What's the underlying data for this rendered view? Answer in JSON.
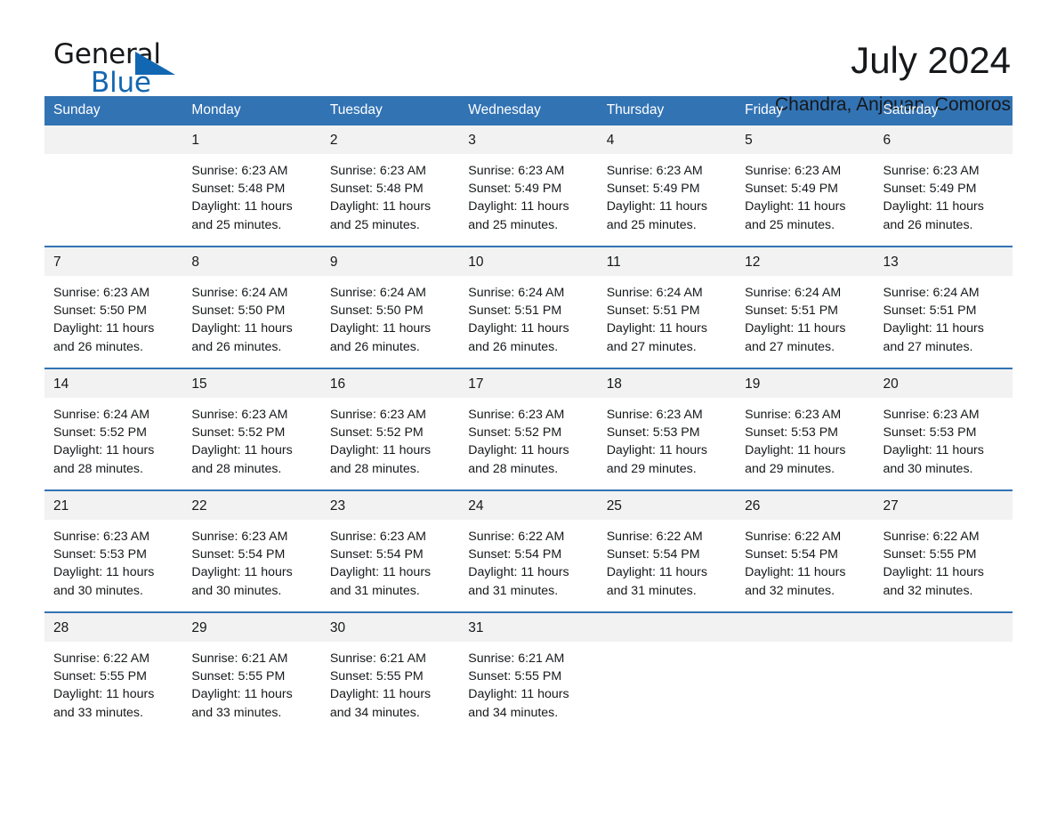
{
  "logo": {
    "word_one": "General",
    "word_two": "Blue",
    "triangle_color": "#1267b2"
  },
  "header": {
    "title": "July 2024",
    "location": "Chandra, Anjouan, Comoros",
    "accent_color": "#3273b4",
    "daynum_background": "#f2f2f2"
  },
  "weekday_headers": [
    "Sunday",
    "Monday",
    "Tuesday",
    "Wednesday",
    "Thursday",
    "Friday",
    "Saturday"
  ],
  "weeks": [
    [
      {
        "day": "",
        "sunrise": "",
        "sunset": "",
        "daylight_line1": "",
        "daylight_line2": ""
      },
      {
        "day": "1",
        "sunrise": "Sunrise: 6:23 AM",
        "sunset": "Sunset: 5:48 PM",
        "daylight_line1": "Daylight: 11 hours",
        "daylight_line2": "and 25 minutes."
      },
      {
        "day": "2",
        "sunrise": "Sunrise: 6:23 AM",
        "sunset": "Sunset: 5:48 PM",
        "daylight_line1": "Daylight: 11 hours",
        "daylight_line2": "and 25 minutes."
      },
      {
        "day": "3",
        "sunrise": "Sunrise: 6:23 AM",
        "sunset": "Sunset: 5:49 PM",
        "daylight_line1": "Daylight: 11 hours",
        "daylight_line2": "and 25 minutes."
      },
      {
        "day": "4",
        "sunrise": "Sunrise: 6:23 AM",
        "sunset": "Sunset: 5:49 PM",
        "daylight_line1": "Daylight: 11 hours",
        "daylight_line2": "and 25 minutes."
      },
      {
        "day": "5",
        "sunrise": "Sunrise: 6:23 AM",
        "sunset": "Sunset: 5:49 PM",
        "daylight_line1": "Daylight: 11 hours",
        "daylight_line2": "and 25 minutes."
      },
      {
        "day": "6",
        "sunrise": "Sunrise: 6:23 AM",
        "sunset": "Sunset: 5:49 PM",
        "daylight_line1": "Daylight: 11 hours",
        "daylight_line2": "and 26 minutes."
      }
    ],
    [
      {
        "day": "7",
        "sunrise": "Sunrise: 6:23 AM",
        "sunset": "Sunset: 5:50 PM",
        "daylight_line1": "Daylight: 11 hours",
        "daylight_line2": "and 26 minutes."
      },
      {
        "day": "8",
        "sunrise": "Sunrise: 6:24 AM",
        "sunset": "Sunset: 5:50 PM",
        "daylight_line1": "Daylight: 11 hours",
        "daylight_line2": "and 26 minutes."
      },
      {
        "day": "9",
        "sunrise": "Sunrise: 6:24 AM",
        "sunset": "Sunset: 5:50 PM",
        "daylight_line1": "Daylight: 11 hours",
        "daylight_line2": "and 26 minutes."
      },
      {
        "day": "10",
        "sunrise": "Sunrise: 6:24 AM",
        "sunset": "Sunset: 5:51 PM",
        "daylight_line1": "Daylight: 11 hours",
        "daylight_line2": "and 26 minutes."
      },
      {
        "day": "11",
        "sunrise": "Sunrise: 6:24 AM",
        "sunset": "Sunset: 5:51 PM",
        "daylight_line1": "Daylight: 11 hours",
        "daylight_line2": "and 27 minutes."
      },
      {
        "day": "12",
        "sunrise": "Sunrise: 6:24 AM",
        "sunset": "Sunset: 5:51 PM",
        "daylight_line1": "Daylight: 11 hours",
        "daylight_line2": "and 27 minutes."
      },
      {
        "day": "13",
        "sunrise": "Sunrise: 6:24 AM",
        "sunset": "Sunset: 5:51 PM",
        "daylight_line1": "Daylight: 11 hours",
        "daylight_line2": "and 27 minutes."
      }
    ],
    [
      {
        "day": "14",
        "sunrise": "Sunrise: 6:24 AM",
        "sunset": "Sunset: 5:52 PM",
        "daylight_line1": "Daylight: 11 hours",
        "daylight_line2": "and 28 minutes."
      },
      {
        "day": "15",
        "sunrise": "Sunrise: 6:23 AM",
        "sunset": "Sunset: 5:52 PM",
        "daylight_line1": "Daylight: 11 hours",
        "daylight_line2": "and 28 minutes."
      },
      {
        "day": "16",
        "sunrise": "Sunrise: 6:23 AM",
        "sunset": "Sunset: 5:52 PM",
        "daylight_line1": "Daylight: 11 hours",
        "daylight_line2": "and 28 minutes."
      },
      {
        "day": "17",
        "sunrise": "Sunrise: 6:23 AM",
        "sunset": "Sunset: 5:52 PM",
        "daylight_line1": "Daylight: 11 hours",
        "daylight_line2": "and 28 minutes."
      },
      {
        "day": "18",
        "sunrise": "Sunrise: 6:23 AM",
        "sunset": "Sunset: 5:53 PM",
        "daylight_line1": "Daylight: 11 hours",
        "daylight_line2": "and 29 minutes."
      },
      {
        "day": "19",
        "sunrise": "Sunrise: 6:23 AM",
        "sunset": "Sunset: 5:53 PM",
        "daylight_line1": "Daylight: 11 hours",
        "daylight_line2": "and 29 minutes."
      },
      {
        "day": "20",
        "sunrise": "Sunrise: 6:23 AM",
        "sunset": "Sunset: 5:53 PM",
        "daylight_line1": "Daylight: 11 hours",
        "daylight_line2": "and 30 minutes."
      }
    ],
    [
      {
        "day": "21",
        "sunrise": "Sunrise: 6:23 AM",
        "sunset": "Sunset: 5:53 PM",
        "daylight_line1": "Daylight: 11 hours",
        "daylight_line2": "and 30 minutes."
      },
      {
        "day": "22",
        "sunrise": "Sunrise: 6:23 AM",
        "sunset": "Sunset: 5:54 PM",
        "daylight_line1": "Daylight: 11 hours",
        "daylight_line2": "and 30 minutes."
      },
      {
        "day": "23",
        "sunrise": "Sunrise: 6:23 AM",
        "sunset": "Sunset: 5:54 PM",
        "daylight_line1": "Daylight: 11 hours",
        "daylight_line2": "and 31 minutes."
      },
      {
        "day": "24",
        "sunrise": "Sunrise: 6:22 AM",
        "sunset": "Sunset: 5:54 PM",
        "daylight_line1": "Daylight: 11 hours",
        "daylight_line2": "and 31 minutes."
      },
      {
        "day": "25",
        "sunrise": "Sunrise: 6:22 AM",
        "sunset": "Sunset: 5:54 PM",
        "daylight_line1": "Daylight: 11 hours",
        "daylight_line2": "and 31 minutes."
      },
      {
        "day": "26",
        "sunrise": "Sunrise: 6:22 AM",
        "sunset": "Sunset: 5:54 PM",
        "daylight_line1": "Daylight: 11 hours",
        "daylight_line2": "and 32 minutes."
      },
      {
        "day": "27",
        "sunrise": "Sunrise: 6:22 AM",
        "sunset": "Sunset: 5:55 PM",
        "daylight_line1": "Daylight: 11 hours",
        "daylight_line2": "and 32 minutes."
      }
    ],
    [
      {
        "day": "28",
        "sunrise": "Sunrise: 6:22 AM",
        "sunset": "Sunset: 5:55 PM",
        "daylight_line1": "Daylight: 11 hours",
        "daylight_line2": "and 33 minutes."
      },
      {
        "day": "29",
        "sunrise": "Sunrise: 6:21 AM",
        "sunset": "Sunset: 5:55 PM",
        "daylight_line1": "Daylight: 11 hours",
        "daylight_line2": "and 33 minutes."
      },
      {
        "day": "30",
        "sunrise": "Sunrise: 6:21 AM",
        "sunset": "Sunset: 5:55 PM",
        "daylight_line1": "Daylight: 11 hours",
        "daylight_line2": "and 34 minutes."
      },
      {
        "day": "31",
        "sunrise": "Sunrise: 6:21 AM",
        "sunset": "Sunset: 5:55 PM",
        "daylight_line1": "Daylight: 11 hours",
        "daylight_line2": "and 34 minutes."
      },
      {
        "day": "",
        "sunrise": "",
        "sunset": "",
        "daylight_line1": "",
        "daylight_line2": ""
      },
      {
        "day": "",
        "sunrise": "",
        "sunset": "",
        "daylight_line1": "",
        "daylight_line2": ""
      },
      {
        "day": "",
        "sunrise": "",
        "sunset": "",
        "daylight_line1": "",
        "daylight_line2": ""
      }
    ]
  ]
}
